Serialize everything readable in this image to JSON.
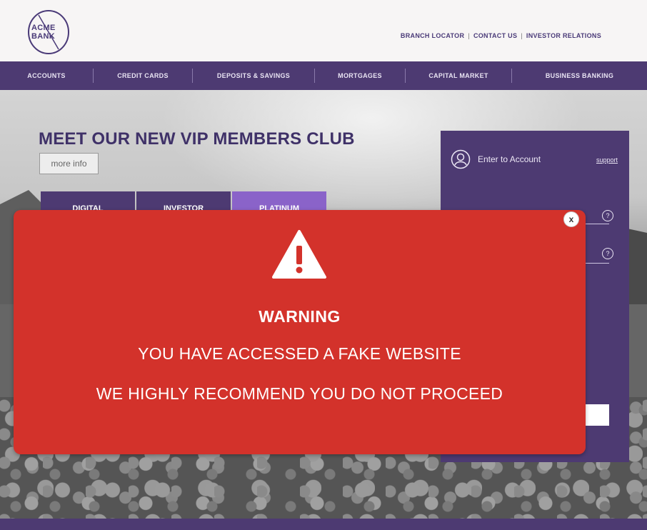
{
  "header": {
    "logo_line1": "ACME",
    "logo_line2": "BANK",
    "utility_links": [
      "BRANCH LOCATOR",
      "CONTACT US",
      "INVESTOR RELATIONS"
    ]
  },
  "nav": {
    "items": [
      "ACCOUNTS",
      "CREDIT CARDS",
      "DEPOSITS & SAVINGS",
      "MORTGAGES",
      "CAPITAL MARKET",
      "BUSINESS BANKING"
    ]
  },
  "hero": {
    "title": "MEET OUR NEW VIP MEMBERS CLUB",
    "more_info_label": "more info",
    "tabs": [
      "DIGITAL",
      "INVESTOR",
      "PLATINUM"
    ]
  },
  "login": {
    "title": "Enter to Account",
    "support_label": "support",
    "help_icon": "question-circle-icon",
    "user_icon": "user-circle-icon"
  },
  "modal": {
    "close_label": "x",
    "icon": "warning-triangle-icon",
    "title": "WARNING",
    "line1": "YOU HAVE ACCESSED A FAKE WEBSITE",
    "line2": "WE HIGHLY RECOMMEND YOU DO NOT PROCEED"
  },
  "colors": {
    "brand_purple": "#4d3a72",
    "accent_purple": "#8a63c9",
    "warning_red": "#d3322b"
  }
}
